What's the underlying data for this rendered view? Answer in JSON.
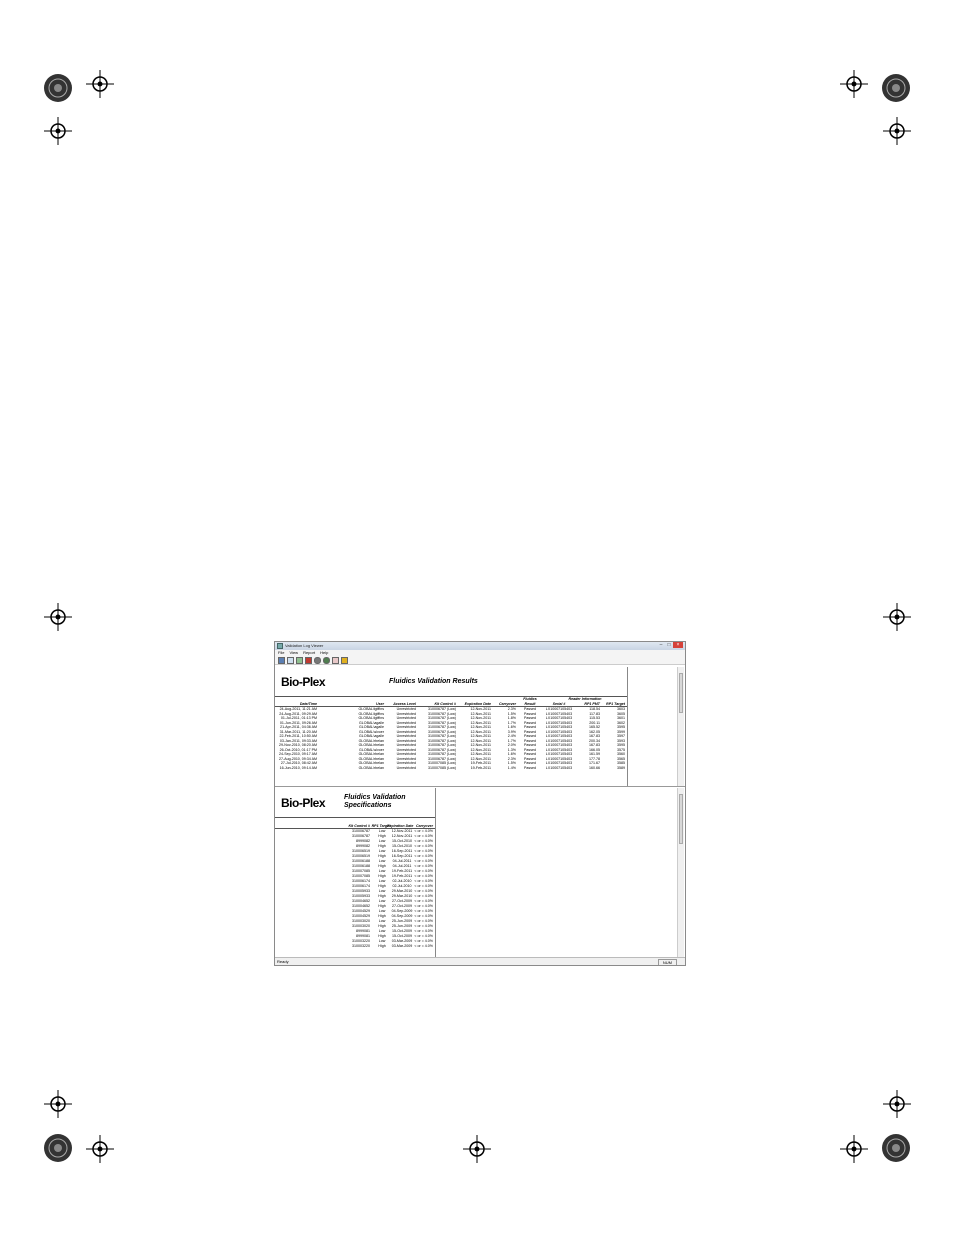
{
  "window": {
    "title": "Validation Log Viewer",
    "menu": [
      "File",
      "View",
      "Report",
      "Help"
    ],
    "toolbar_icons": [
      "open-icon",
      "view-icon",
      "refresh-icon",
      "export-icon",
      "print-icon",
      "print-preview-icon",
      "mail-icon",
      "help-icon"
    ],
    "status_text": "Ready",
    "status_indicator": "NUM"
  },
  "top_report": {
    "logo": "Bio-Plex",
    "title": "Fluidics Validation Results",
    "group_headers": {
      "fluidics": "Fluidics",
      "reader": "Reader Information"
    },
    "columns": [
      "Date/Time",
      "User",
      "Access Level",
      "Kit Control #",
      "Expiration Date",
      "Carryover",
      "Result",
      "Serial #",
      "RP1 PMT",
      "RP1 Target"
    ],
    "rows": [
      [
        "24-Aug-2011, 11:21 AM",
        "GLOBAL\\lgiffins",
        "Unrestricted",
        "310006787 (Low)",
        "12-Nov-2011",
        "2.3%",
        "Passed",
        "LX10007105403",
        "118.54",
        "3603"
      ],
      [
        "24-Aug-2011, 09:29 AM",
        "GLOBAL\\lgiffins",
        "Unrestricted",
        "310006787 (Low)",
        "12-Nov-2011",
        "1.5%",
        "Passed",
        "LX10007105403",
        "117.83",
        "3605"
      ],
      [
        "01-Jul-2011, 01:13 PM",
        "GLOBAL\\lgiffins",
        "Unrestricted",
        "310006787 (Low)",
        "12-Nov-2011",
        "1.8%",
        "Passed",
        "LX10007105403",
        "115.53",
        "3601"
      ],
      [
        "01-Jun-2011, 09:26 AM",
        "GLOBAL\\agalle",
        "Unrestricted",
        "310006787 (Low)",
        "12-Nov-2011",
        "1.7%",
        "Passed",
        "LX10007105403",
        "200.11",
        "3602"
      ],
      [
        "21-Apr-2011, 04:36 AM",
        "GLOBAL\\agalle",
        "Unrestricted",
        "310006787 (Low)",
        "12-Nov-2011",
        "1.6%",
        "Passed",
        "LX10007105403",
        "165.52",
        "3595"
      ],
      [
        "31-Mar-2011, 11:20 AM",
        "GLOBAL\\slvoer",
        "Unrestricted",
        "310006787 (Low)",
        "12-Nov-2011",
        "3.9%",
        "Passed",
        "LX10007105403",
        "162.05",
        "3599"
      ],
      [
        "22-Feb-2011, 10:50 AM",
        "GLOBAL\\agalle",
        "Unrestricted",
        "310006787 (Low)",
        "12-Nov-2011",
        "2.4%",
        "Passed",
        "LX10007105403",
        "167.83",
        "3597"
      ],
      [
        "03-Jan-2011, 09:33 AM",
        "GLOBAL\\rbelan",
        "Unrestricted",
        "310006787 (Low)",
        "12-Nov-2011",
        "1.7%",
        "Passed",
        "LX10007105403",
        "200.34",
        "3593"
      ],
      [
        "29-Nov-2010, 08:20 AM",
        "GLOBAL\\rbelan",
        "Unrestricted",
        "310006787 (Low)",
        "12-Nov-2011",
        "2.0%",
        "Passed",
        "LX10007105403",
        "167.83",
        "3595"
      ],
      [
        "26-Oct-2010, 01:17 PM",
        "GLOBAL\\slvoer",
        "Unrestricted",
        "310006787 (Low)",
        "12-Nov-2011",
        "1.3%",
        "Passed",
        "LX10007105403",
        "166.05",
        "3575"
      ],
      [
        "24-Sep-2010, 09:17 AM",
        "GLOBAL\\rbelan",
        "Unrestricted",
        "310006787 (Low)",
        "12-Nov-2011",
        "1.6%",
        "Passed",
        "LX10007105403",
        "161.59",
        "3560"
      ],
      [
        "27-Aug-2010, 09:34 AM",
        "GLOBAL\\rbelan",
        "Unrestricted",
        "310006787 (Low)",
        "12-Nov-2011",
        "2.3%",
        "Passed",
        "LX10007105403",
        "177.78",
        "3565"
      ],
      [
        "27-Jul-2010, 08:42 AM",
        "GLOBAL\\rbelan",
        "Unrestricted",
        "310007085 (Low)",
        "19-Feb-2011",
        "1.5%",
        "Passed",
        "LX10007105403",
        "171.67",
        "3585"
      ],
      [
        "16-Jun-2010, 09:14 AM",
        "GLOBAL\\rbelan",
        "Unrestricted",
        "310007085 (Low)",
        "19-Feb-2011",
        "1.4%",
        "Passed",
        "LX10007105403",
        "160.66",
        "3589"
      ]
    ]
  },
  "bottom_report": {
    "logo": "Bio-Plex",
    "title_line1": "Fluidics Validation",
    "title_line2": "Specifications",
    "columns": [
      "Kit Control #",
      "RP1 Target",
      "Expiration Date",
      "Carryover"
    ],
    "rows": [
      [
        "310006787",
        "Low",
        "12-Nov-2011",
        "< or = 4.0%"
      ],
      [
        "310006787",
        "High",
        "12-Nov-2011",
        "< or = 4.0%"
      ],
      [
        "8999082",
        "Low",
        "15-Oct-2010",
        "< or = 4.0%"
      ],
      [
        "8999082",
        "High",
        "15-Oct-2010",
        "< or = 4.0%"
      ],
      [
        "310006519",
        "Low",
        "16-Sep-2011",
        "< or = 4.0%"
      ],
      [
        "310006519",
        "High",
        "16-Sep-2011",
        "< or = 4.0%"
      ],
      [
        "310006188",
        "Low",
        "04-Jul-2011",
        "< or = 4.0%"
      ],
      [
        "310006188",
        "High",
        "04-Jul-2011",
        "< or = 4.0%"
      ],
      [
        "310007085",
        "Low",
        "19-Feb-2011",
        "< or = 4.0%"
      ],
      [
        "310007085",
        "High",
        "19-Feb-2011",
        "< or = 4.0%"
      ],
      [
        "310006174",
        "Low",
        "02-Jul-2010",
        "< or = 4.0%"
      ],
      [
        "310006174",
        "High",
        "02-Jul-2010",
        "< or = 4.0%"
      ],
      [
        "310005933",
        "Low",
        "29-Mar-2010",
        "< or = 4.0%"
      ],
      [
        "310005933",
        "High",
        "29-Mar-2010",
        "< or = 4.0%"
      ],
      [
        "310004652",
        "Low",
        "27-Oct-2009",
        "< or = 4.0%"
      ],
      [
        "310004652",
        "High",
        "27-Oct-2009",
        "< or = 4.0%"
      ],
      [
        "310004529",
        "Low",
        "04-Sep-2009",
        "< or = 4.0%"
      ],
      [
        "310004529",
        "High",
        "04-Sep-2009",
        "< or = 4.0%"
      ],
      [
        "310003020",
        "Low",
        "25-Jun-2009",
        "< or = 4.0%"
      ],
      [
        "310003020",
        "High",
        "25-Jun-2009",
        "< or = 4.0%"
      ],
      [
        "8999081",
        "Low",
        "15-Oct-2009",
        "< or = 4.0%"
      ],
      [
        "8999081",
        "High",
        "15-Oct-2009",
        "< or = 4.0%"
      ],
      [
        "310003220",
        "Low",
        "03-Mar-2009",
        "< or = 4.0%"
      ],
      [
        "310003220",
        "High",
        "03-Mar-2009",
        "< or = 4.0%"
      ]
    ]
  }
}
